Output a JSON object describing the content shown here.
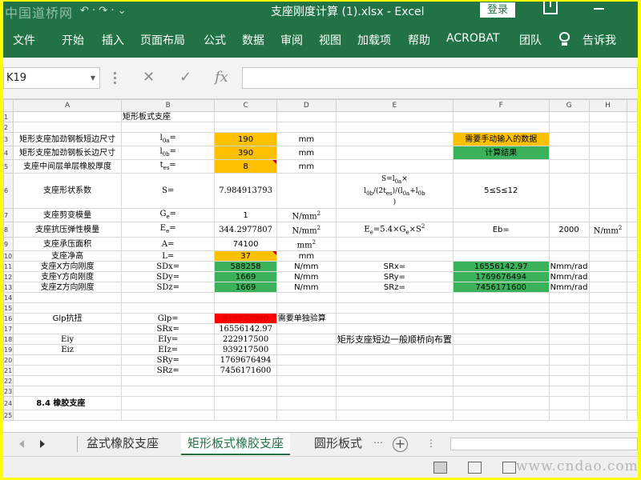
{
  "titlebar": {
    "watermark": "中国道桥网",
    "quick_access": "↶ · ↷ ·  ⌄",
    "document": "支座刚度计算 (1).xlsx  -  Excel",
    "login": "登录"
  },
  "ribbon": {
    "tabs": [
      "文件",
      "开始",
      "插入",
      "页面布局",
      "公式",
      "数据",
      "审阅",
      "视图",
      "加载项",
      "帮助",
      "ACROBAT",
      "团队",
      "告诉我"
    ]
  },
  "formula_bar": {
    "name_box": "K19",
    "icons": [
      "cancel-icon",
      "enter-icon",
      "function-icon"
    ],
    "value": ""
  },
  "columns": [
    "A",
    "B",
    "C",
    "D",
    "E",
    "F",
    "G",
    "H"
  ],
  "rows": [
    {
      "n": "1",
      "cells": {
        "B": "矩形板式支座"
      }
    },
    {
      "n": "2",
      "cells": {}
    },
    {
      "n": "3",
      "cells": {
        "A": "矩形支座加劲钢板短边尺寸",
        "B": "l0a=",
        "C": "190",
        "D": "mm",
        "F": "需要手动输入的数据"
      }
    },
    {
      "n": "4",
      "cells": {
        "A": "矩形支座加劲钢板长边尺寸",
        "B": "l0b=",
        "C": "390",
        "D": "mm",
        "F": "计算结果"
      }
    },
    {
      "n": "5",
      "cells": {
        "A": "支座中间层单层橡胶厚度",
        "B": "tes=",
        "C": "8",
        "D": "mm"
      }
    },
    {
      "n": "6",
      "cells": {
        "A": "支座形状系数",
        "B": "S=",
        "C": "7.984913793",
        "E": "S=l0a×l0b/(2tes)/(l0a+l0b)",
        "F": "5≤S≤12"
      }
    },
    {
      "n": "7",
      "cells": {
        "A": "支座剪变模量",
        "B": "Ge=",
        "C": "1",
        "D": "N/mm2"
      }
    },
    {
      "n": "8",
      "cells": {
        "A": "支座抗压弹性模量",
        "B": "Ee=",
        "C": "344.2977807",
        "D": "N/mm2",
        "E": "Ee=5.4×Ge×S2",
        "F": "Eb=",
        "G": "2000",
        "H": "N/mm2"
      }
    },
    {
      "n": "9",
      "cells": {
        "A": "支座承压面积",
        "B": "A=",
        "C": "74100",
        "D": "mm2"
      }
    },
    {
      "n": "10",
      "cells": {
        "A": "支座净高",
        "B": "L=",
        "C": "37",
        "D": "mm"
      }
    },
    {
      "n": "11",
      "cells": {
        "A": "支座X方向刚度",
        "B": "SDx=",
        "C": "588258",
        "D": "N/mm",
        "E": "SRx=",
        "F": "16556142.97",
        "G": "Nmm/rad"
      }
    },
    {
      "n": "12",
      "cells": {
        "A": "支座Y方向刚度",
        "B": "SDy=",
        "C": "1669",
        "D": "N/mm",
        "E": "SRy=",
        "F": "1769676494",
        "G": "Nmm/rad"
      }
    },
    {
      "n": "13",
      "cells": {
        "A": "支座Z方向刚度",
        "B": "SDz=",
        "C": "1669",
        "D": "N/mm",
        "E": "SRz=",
        "F": "7456171600",
        "G": "Nmm/rad"
      }
    },
    {
      "n": "14",
      "cells": {}
    },
    {
      "n": "15",
      "cells": {}
    },
    {
      "n": "16",
      "cells": {
        "A": "Glp抗扭",
        "B": "Glp=",
        "C": "812377890",
        "D": "需要单独验算"
      }
    },
    {
      "n": "17",
      "cells": {
        "B": "SRx=",
        "C": "16556142.97"
      }
    },
    {
      "n": "18",
      "cells": {
        "A": "Eiy",
        "B": "EIy=",
        "C": "222917500",
        "E": "矩形支座短边一般顺桥向布置"
      }
    },
    {
      "n": "19",
      "cells": {
        "A": "Eiz",
        "B": "EIz=",
        "C": "939217500"
      }
    },
    {
      "n": "20",
      "cells": {
        "B": "SRy=",
        "C": "1769676494"
      }
    },
    {
      "n": "21",
      "cells": {
        "B": "SRz=",
        "C": "7456171600"
      }
    },
    {
      "n": "22",
      "cells": {}
    },
    {
      "n": "23",
      "cells": {}
    },
    {
      "n": "24",
      "cells": {
        "A": "8.4   橡胶支座"
      }
    },
    {
      "n": "25",
      "cells": {}
    }
  ],
  "sheet_tabs": [
    "盆式橡胶支座",
    "矩形板式橡胶支座",
    "圆形板式"
  ],
  "active_sheet": "矩形板式橡胶支座",
  "add_sheet": "+",
  "status_watermark": "www.cndao.com",
  "colors": {
    "excel_green": "#217346",
    "input_orange": "#ffc000",
    "result_green": "#3bb25a",
    "alert_red": "#ff0000"
  }
}
